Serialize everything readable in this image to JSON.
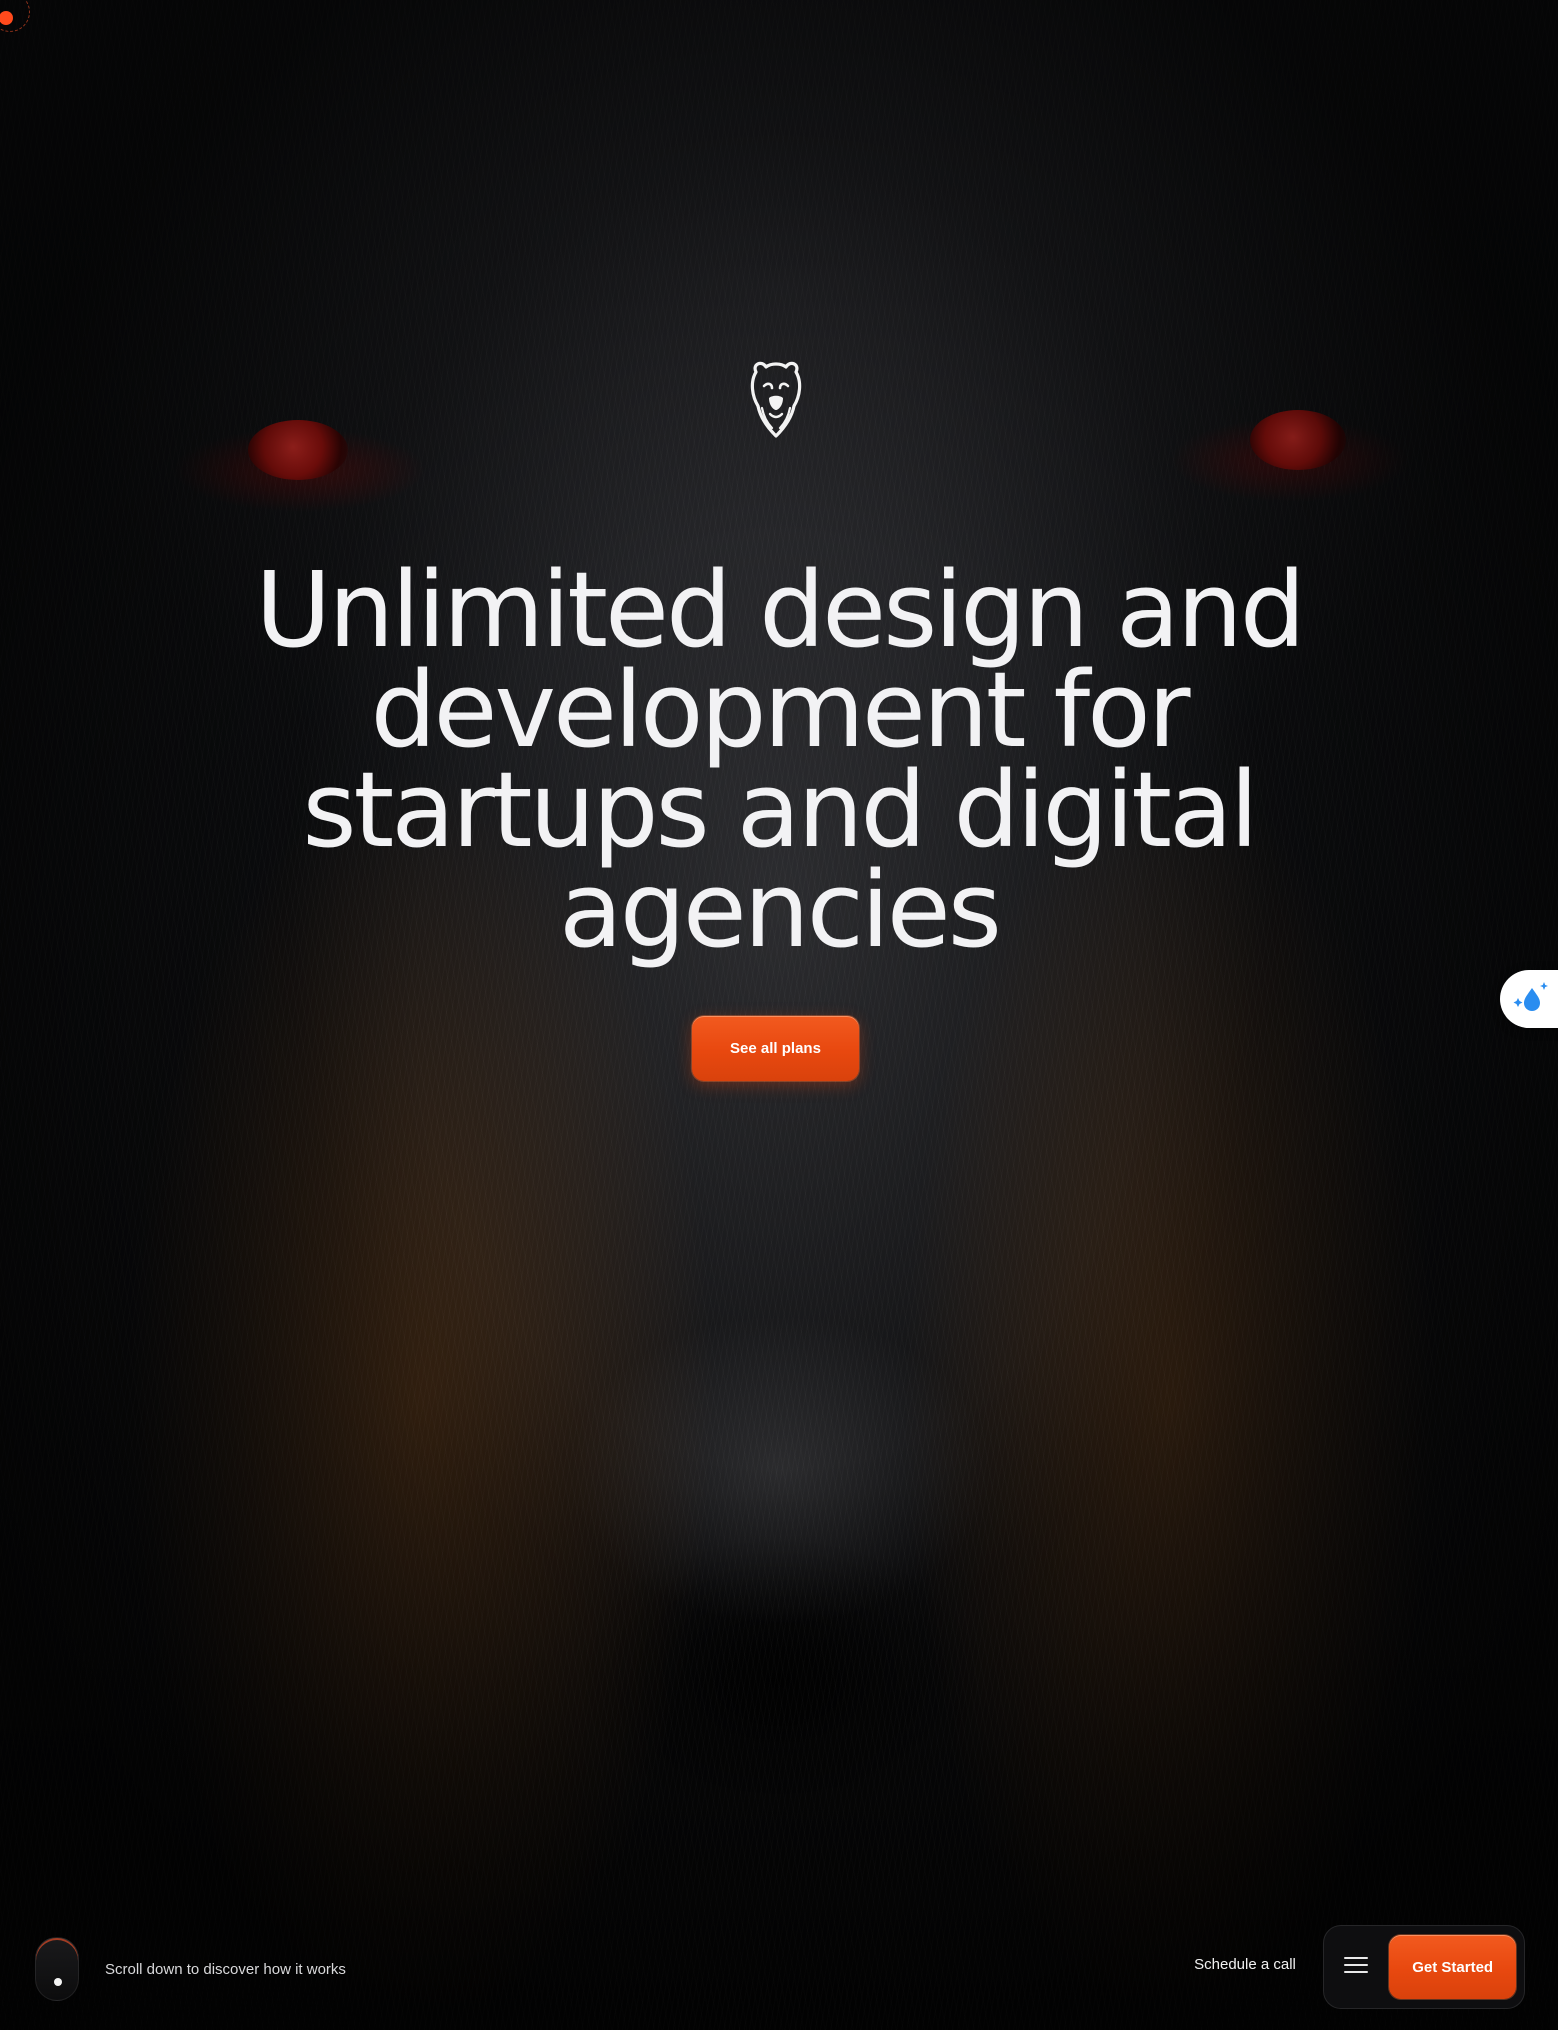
{
  "hero": {
    "title": "Unlimited design and development for startups and digital agencies",
    "cta_label": "See all plans"
  },
  "footer": {
    "scroll_hint": "Scroll down to discover how it works",
    "schedule_label": "Schedule a call",
    "get_started_label": "Get Started"
  },
  "icons": {
    "logo": "bear-head-logo",
    "menu": "hamburger-menu-icon",
    "side_widget": "droplet-sparkle-icon",
    "scroll": "mouse-scroll-icon"
  },
  "colors": {
    "accent": "#ec4e14",
    "text": "#f2f2f4",
    "background": "#0b0b0d"
  }
}
